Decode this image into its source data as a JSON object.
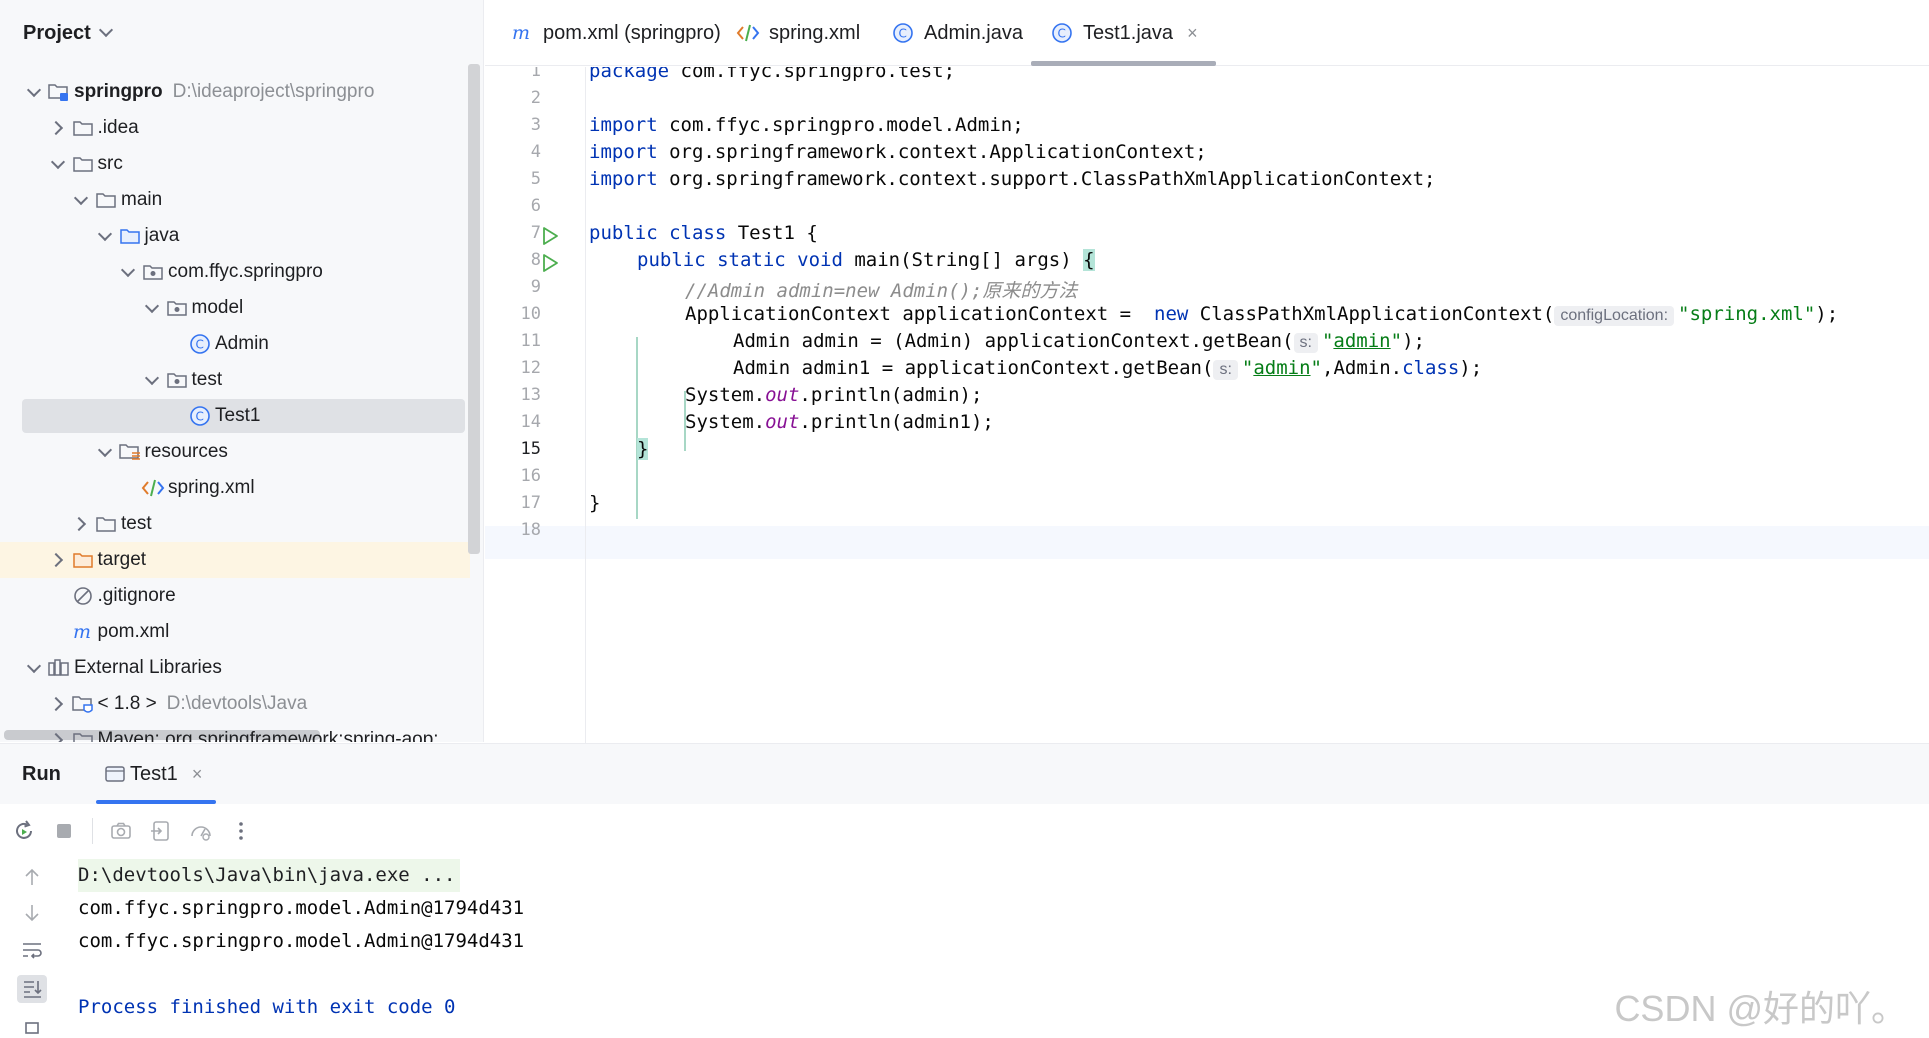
{
  "project": {
    "title": "Project",
    "tree": [
      {
        "label": "springpro",
        "path": "D:\\ideaproject\\springpro",
        "icon": "module-folder-icon",
        "arrow": "down",
        "depth": 0,
        "bold": true
      },
      {
        "label": ".idea",
        "icon": "folder-icon",
        "arrow": "right",
        "depth": 1
      },
      {
        "label": "src",
        "icon": "folder-icon",
        "arrow": "down",
        "depth": 1
      },
      {
        "label": "main",
        "icon": "folder-icon",
        "arrow": "down",
        "depth": 2
      },
      {
        "label": "java",
        "icon": "source-folder-icon",
        "arrow": "down",
        "depth": 3
      },
      {
        "label": "com.ffyc.springpro",
        "icon": "package-icon",
        "arrow": "down",
        "depth": 4
      },
      {
        "label": "model",
        "icon": "package-icon",
        "arrow": "down",
        "depth": 5
      },
      {
        "label": "Admin",
        "icon": "class-icon",
        "arrow": "none",
        "depth": 6
      },
      {
        "label": "test",
        "icon": "package-icon",
        "arrow": "down",
        "depth": 5
      },
      {
        "label": "Test1",
        "icon": "class-icon",
        "arrow": "none",
        "depth": 6,
        "selected": true
      },
      {
        "label": "resources",
        "icon": "resources-folder-icon",
        "arrow": "down",
        "depth": 3
      },
      {
        "label": "spring.xml",
        "icon": "xml-file-icon",
        "arrow": "none",
        "depth": 4
      },
      {
        "label": "test",
        "icon": "folder-icon",
        "arrow": "right",
        "depth": 2
      },
      {
        "label": "target",
        "icon": "excluded-folder-icon",
        "arrow": "right",
        "depth": 1,
        "highlight": true
      },
      {
        "label": ".gitignore",
        "icon": "ignored-file-icon",
        "arrow": "none",
        "depth": 1
      },
      {
        "label": "pom.xml",
        "icon": "maven-file-icon",
        "arrow": "none",
        "depth": 1
      },
      {
        "label": "External Libraries",
        "icon": "libraries-icon",
        "arrow": "down",
        "depth": 0
      },
      {
        "label": "< 1.8 >",
        "path": "D:\\devtools\\Java",
        "icon": "jdk-icon",
        "arrow": "right",
        "depth": 1
      },
      {
        "label": "Maven: org.springframework:spring-aop:",
        "icon": "library-folder-icon",
        "arrow": "right",
        "depth": 1
      }
    ]
  },
  "editor_tabs": [
    {
      "label": "pom.xml (springpro)",
      "icon": "maven-file-icon"
    },
    {
      "label": "spring.xml",
      "icon": "xml-file-icon"
    },
    {
      "label": "Admin.java",
      "icon": "class-icon"
    },
    {
      "label": "Test1.java",
      "icon": "class-icon",
      "active": true,
      "close": "×"
    }
  ],
  "editor": {
    "line_numbers": [
      "1",
      "2",
      "3",
      "4",
      "5",
      "6",
      "7",
      "8",
      "9",
      "10",
      "11",
      "12",
      "13",
      "14",
      "15",
      "16",
      "17",
      "18"
    ],
    "current_line": "15",
    "run_gutter_lines": [
      "7",
      "8"
    ],
    "code": {
      "l1_kw": "package",
      "l1_rest": " com.ffyc.springpro.test;",
      "l3_kw": "import",
      "l3_rest": " com.ffyc.springpro.model.Admin;",
      "l4_kw": "import",
      "l4_rest": " org.springframework.context.ApplicationContext;",
      "l5_kw": "import",
      "l5_rest": " org.springframework.context.support.ClassPathXmlApplicationContext;",
      "l7_kw": "public class",
      "l7_rest": " Test1 {",
      "l8_kw": "public static void",
      "l8_rest": " main(String[] args) ",
      "l8_brace": "{",
      "l9_comment": "//Admin admin=new Admin();原来的方法",
      "l10_a": "ApplicationContext applicationContext =  ",
      "l10_kw": "new",
      "l10_b": " ClassPathXmlApplicationContext(",
      "l10_hint": "configLocation:",
      "l10_str": "\"spring.xml\"",
      "l10_c": ");",
      "l11_a": "Admin admin = (Admin) applicationContext.getBean(",
      "l11_hint": "s:",
      "l11_q1": "\"",
      "l11_str": "admin",
      "l11_q2": "\"",
      "l11_c": ");",
      "l12_a": "Admin admin1 = applicationContext.getBean(",
      "l12_hint": "s:",
      "l12_q1": "\"",
      "l12_str": "admin",
      "l12_q2": "\"",
      "l12_b": ",Admin.",
      "l12_kw": "class",
      "l12_c": ");",
      "l13_a": "System.",
      "l13_fld": "out",
      "l13_b": ".println(admin);",
      "l14_a": "System.",
      "l14_fld": "out",
      "l14_b": ".println(admin1);",
      "l15_brace": "}",
      "l17": "}"
    }
  },
  "run": {
    "title": "Run",
    "tab_label": "Test1",
    "tab_close": "×",
    "toolbar_icons": [
      "rerun-icon",
      "stop-icon",
      "screenshot-icon",
      "exit-icon",
      "profiler-icon",
      "more-icon"
    ],
    "side_icons": [
      "scroll-up-icon",
      "scroll-down-icon",
      "soft-wrap-icon",
      "scroll-to-end-icon",
      "print-icon"
    ],
    "console": [
      "D:\\devtools\\Java\\bin\\java.exe ...",
      "com.ffyc.springpro.model.Admin@1794d431",
      "com.ffyc.springpro.model.Admin@1794d431",
      "",
      "Process finished with exit code 0"
    ]
  },
  "watermark": "CSDN @好的吖。",
  "colors": {
    "keyword": "#0033b3",
    "string": "#067d17",
    "comment": "#8c8c8c",
    "accent": "#3574f0",
    "run_green": "#4cae4f"
  }
}
